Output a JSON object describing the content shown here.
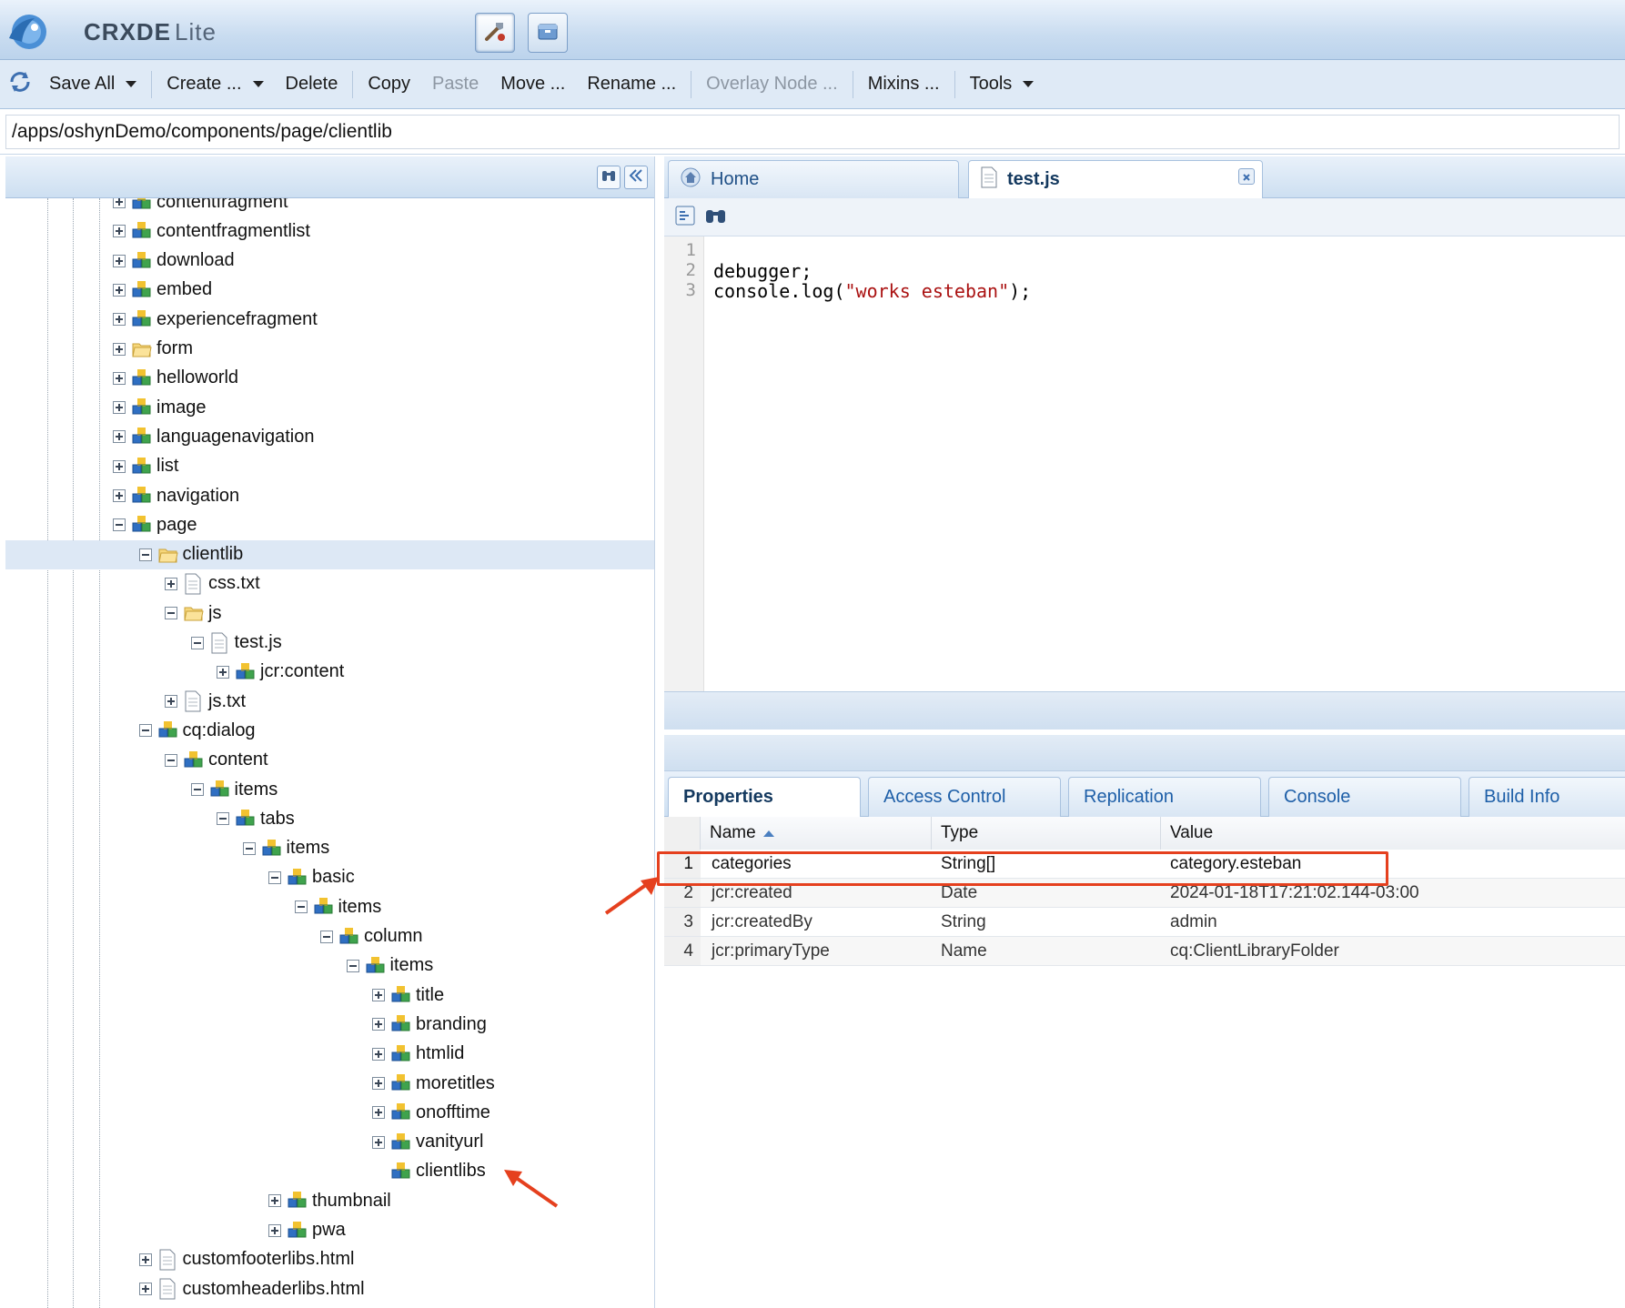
{
  "app": {
    "title_main": "CRXDE",
    "title_sub": "Lite",
    "logo_icon": "crx-logo-icon",
    "header_buttons": [
      "tools-icon",
      "packages-icon"
    ]
  },
  "toolbar": {
    "save_all": "Save All",
    "create": "Create ...",
    "delete": "Delete",
    "copy": "Copy",
    "paste": "Paste",
    "move": "Move ...",
    "rename": "Rename ...",
    "overlay_node": "Overlay Node ...",
    "mixins": "Mixins ...",
    "tools": "Tools"
  },
  "path": {
    "value": "/apps/oshynDemo/components/page/clientlib"
  },
  "tree": {
    "nodes": [
      {
        "label": "contentfragment",
        "depth": 4,
        "expanded": false,
        "icon": "component"
      },
      {
        "label": "contentfragmentlist",
        "depth": 4,
        "expanded": false,
        "icon": "component"
      },
      {
        "label": "download",
        "depth": 4,
        "expanded": false,
        "icon": "component"
      },
      {
        "label": "embed",
        "depth": 4,
        "expanded": false,
        "icon": "component"
      },
      {
        "label": "experiencefragment",
        "depth": 4,
        "expanded": false,
        "icon": "component"
      },
      {
        "label": "form",
        "depth": 4,
        "expanded": false,
        "icon": "folder"
      },
      {
        "label": "helloworld",
        "depth": 4,
        "expanded": false,
        "icon": "component"
      },
      {
        "label": "image",
        "depth": 4,
        "expanded": false,
        "icon": "component"
      },
      {
        "label": "languagenavigation",
        "depth": 4,
        "expanded": false,
        "icon": "component"
      },
      {
        "label": "list",
        "depth": 4,
        "expanded": false,
        "icon": "component"
      },
      {
        "label": "navigation",
        "depth": 4,
        "expanded": false,
        "icon": "component"
      },
      {
        "label": "page",
        "depth": 4,
        "expanded": true,
        "icon": "component"
      },
      {
        "label": "clientlib",
        "depth": 5,
        "expanded": true,
        "icon": "folder",
        "selected": true
      },
      {
        "label": "css.txt",
        "depth": 6,
        "expanded": false,
        "icon": "file"
      },
      {
        "label": "js",
        "depth": 6,
        "expanded": true,
        "icon": "folder"
      },
      {
        "label": "test.js",
        "depth": 7,
        "expanded": true,
        "icon": "file"
      },
      {
        "label": "jcr:content",
        "depth": 8,
        "expanded": false,
        "icon": "component"
      },
      {
        "label": "js.txt",
        "depth": 6,
        "expanded": false,
        "icon": "file"
      },
      {
        "label": "cq:dialog",
        "depth": 5,
        "expanded": true,
        "icon": "component"
      },
      {
        "label": "content",
        "depth": 6,
        "expanded": true,
        "icon": "component"
      },
      {
        "label": "items",
        "depth": 7,
        "expanded": true,
        "icon": "component"
      },
      {
        "label": "tabs",
        "depth": 8,
        "expanded": true,
        "icon": "component"
      },
      {
        "label": "items",
        "depth": 9,
        "expanded": true,
        "icon": "component"
      },
      {
        "label": "basic",
        "depth": 10,
        "expanded": true,
        "icon": "component"
      },
      {
        "label": "items",
        "depth": 11,
        "expanded": true,
        "icon": "component"
      },
      {
        "label": "column",
        "depth": 12,
        "expanded": true,
        "icon": "component"
      },
      {
        "label": "items",
        "depth": 13,
        "expanded": true,
        "icon": "component"
      },
      {
        "label": "title",
        "depth": 14,
        "expanded": false,
        "icon": "component"
      },
      {
        "label": "branding",
        "depth": 14,
        "expanded": false,
        "icon": "component"
      },
      {
        "label": "htmlid",
        "depth": 14,
        "expanded": false,
        "icon": "component"
      },
      {
        "label": "moretitles",
        "depth": 14,
        "expanded": false,
        "icon": "component"
      },
      {
        "label": "onofftime",
        "depth": 14,
        "expanded": false,
        "icon": "component"
      },
      {
        "label": "vanityurl",
        "depth": 14,
        "expanded": false,
        "icon": "component"
      },
      {
        "label": "clientlibs",
        "depth": 14,
        "expanded": null,
        "icon": "component"
      },
      {
        "label": "thumbnail",
        "depth": 10,
        "expanded": false,
        "icon": "component"
      },
      {
        "label": "pwa",
        "depth": 10,
        "expanded": false,
        "icon": "component"
      },
      {
        "label": "customfooterlibs.html",
        "depth": 5,
        "expanded": false,
        "icon": "file"
      },
      {
        "label": "customheaderlibs.html",
        "depth": 5,
        "expanded": false,
        "icon": "file"
      }
    ]
  },
  "editor": {
    "tabs": [
      {
        "label": "Home",
        "icon": "home-icon"
      },
      {
        "label": "test.js",
        "icon": "file-icon",
        "active": true
      }
    ],
    "line_numbers": [
      "1",
      "2",
      "3"
    ],
    "code": {
      "line1": "",
      "line2": "debugger;",
      "line3_pre": "console.log(",
      "line3_str": "\"works esteban\"",
      "line3_post": ");"
    }
  },
  "properties": {
    "tabs": [
      "Properties",
      "Access Control",
      "Replication",
      "Console",
      "Build Info"
    ],
    "columns": {
      "name": "Name",
      "type": "Type",
      "value": "Value"
    },
    "rows": [
      {
        "num": "1",
        "name": "categories",
        "type": "String[]",
        "value": "category.esteban"
      },
      {
        "num": "2",
        "name": "jcr:created",
        "type": "Date",
        "value": "2024-01-18T17:21:02.144-03:00"
      },
      {
        "num": "3",
        "name": "jcr:createdBy",
        "type": "String",
        "value": "admin"
      },
      {
        "num": "4",
        "name": "jcr:primaryType",
        "type": "Name",
        "value": "cq:ClientLibraryFolder"
      }
    ]
  },
  "colors": {
    "header_bg": "#c9dcf0",
    "accent_blue": "#1e5fa8",
    "annotation_red": "#e5401e"
  }
}
